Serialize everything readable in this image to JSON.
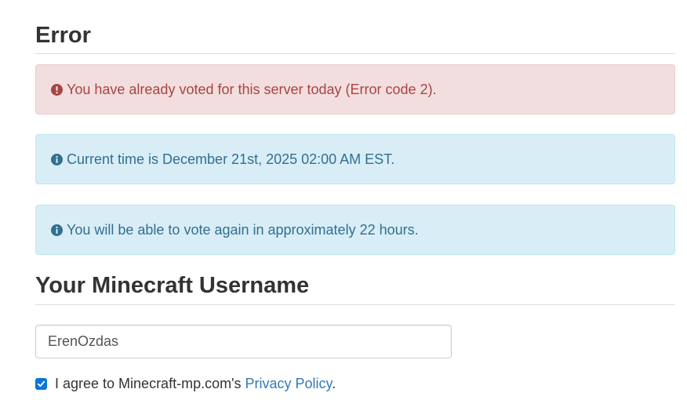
{
  "error_section": {
    "heading": "Error"
  },
  "alerts": {
    "error": {
      "text": "You have already voted for this server today (Error code 2).",
      "icon": "exclamation-circle-icon",
      "color": "#a94442"
    },
    "time": {
      "text": "Current time is December 21st, 2025 02:00 AM EST.",
      "icon": "info-circle-icon",
      "color": "#31708f"
    },
    "wait": {
      "text": "You will be able to vote again in approximately 22 hours.",
      "icon": "info-circle-icon",
      "color": "#31708f"
    }
  },
  "username_section": {
    "heading": "Your Minecraft Username",
    "input_value": "ErenOzdas"
  },
  "agreement": {
    "checked": true,
    "prefix": "I agree to Minecraft-mp.com's ",
    "link_text": "Privacy Policy",
    "suffix": ".",
    "checkbox_color": "#0b75d9",
    "link_color": "#337ab7"
  }
}
